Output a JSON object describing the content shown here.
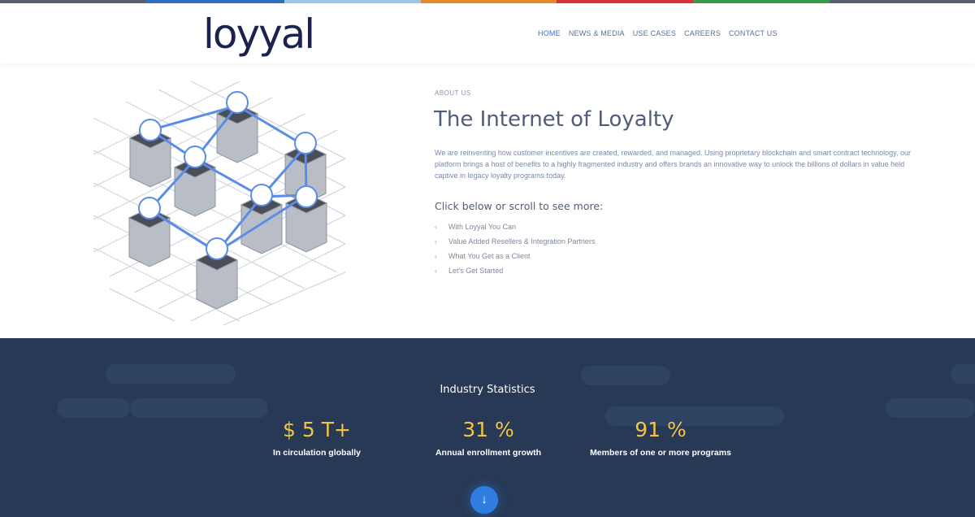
{
  "brand": {
    "logo_text": "loyyal"
  },
  "strip_colors": [
    "#5b6170",
    "#2f6fbf",
    "#9ec7e8",
    "#e8892b",
    "#d6343a",
    "#3a9a48",
    "#5b6170"
  ],
  "nav": {
    "items": [
      {
        "label": "HOME",
        "active": true
      },
      {
        "label": "NEWS & MEDIA",
        "active": false
      },
      {
        "label": "USE CASES",
        "active": false
      },
      {
        "label": "CAREERS",
        "active": false
      },
      {
        "label": "CONTACT US",
        "active": false
      }
    ]
  },
  "about": {
    "label": "ABOUT US",
    "title": "The Internet of Loyalty",
    "body": "We are reinventing how customer incentives are created, rewarded, and managed. Using proprietary blockchain and smart contract technology, our platform brings a host of benefits to a highly fragmented industry and offers brands an innovative way to unlock the billions of dollars in value held captive in legacy loyalty programs today.",
    "click_below": "Click below or scroll to see more:",
    "links": [
      "With Loyyal You Can",
      "Value Added Resellers & Integration Partners",
      "What You Get as a Client",
      "Let's Get Started"
    ]
  },
  "stats": {
    "title": "Industry Statistics",
    "items": [
      {
        "value": "$ 5 T+",
        "caption": "In circulation globally"
      },
      {
        "value": "31 %",
        "caption": "Annual enrollment growth"
      },
      {
        "value": "91 %",
        "caption": "Members of one or more programs"
      }
    ]
  },
  "icons": {
    "share": "share-icon",
    "scroll_down": "arrow-down-icon",
    "illustration": "blockchain-network-illustration"
  },
  "colors": {
    "accent_blue": "#2f7de1",
    "stats_bg": "#273955",
    "stat_value": "#f3c44a",
    "title_text": "#4f5c7a"
  }
}
